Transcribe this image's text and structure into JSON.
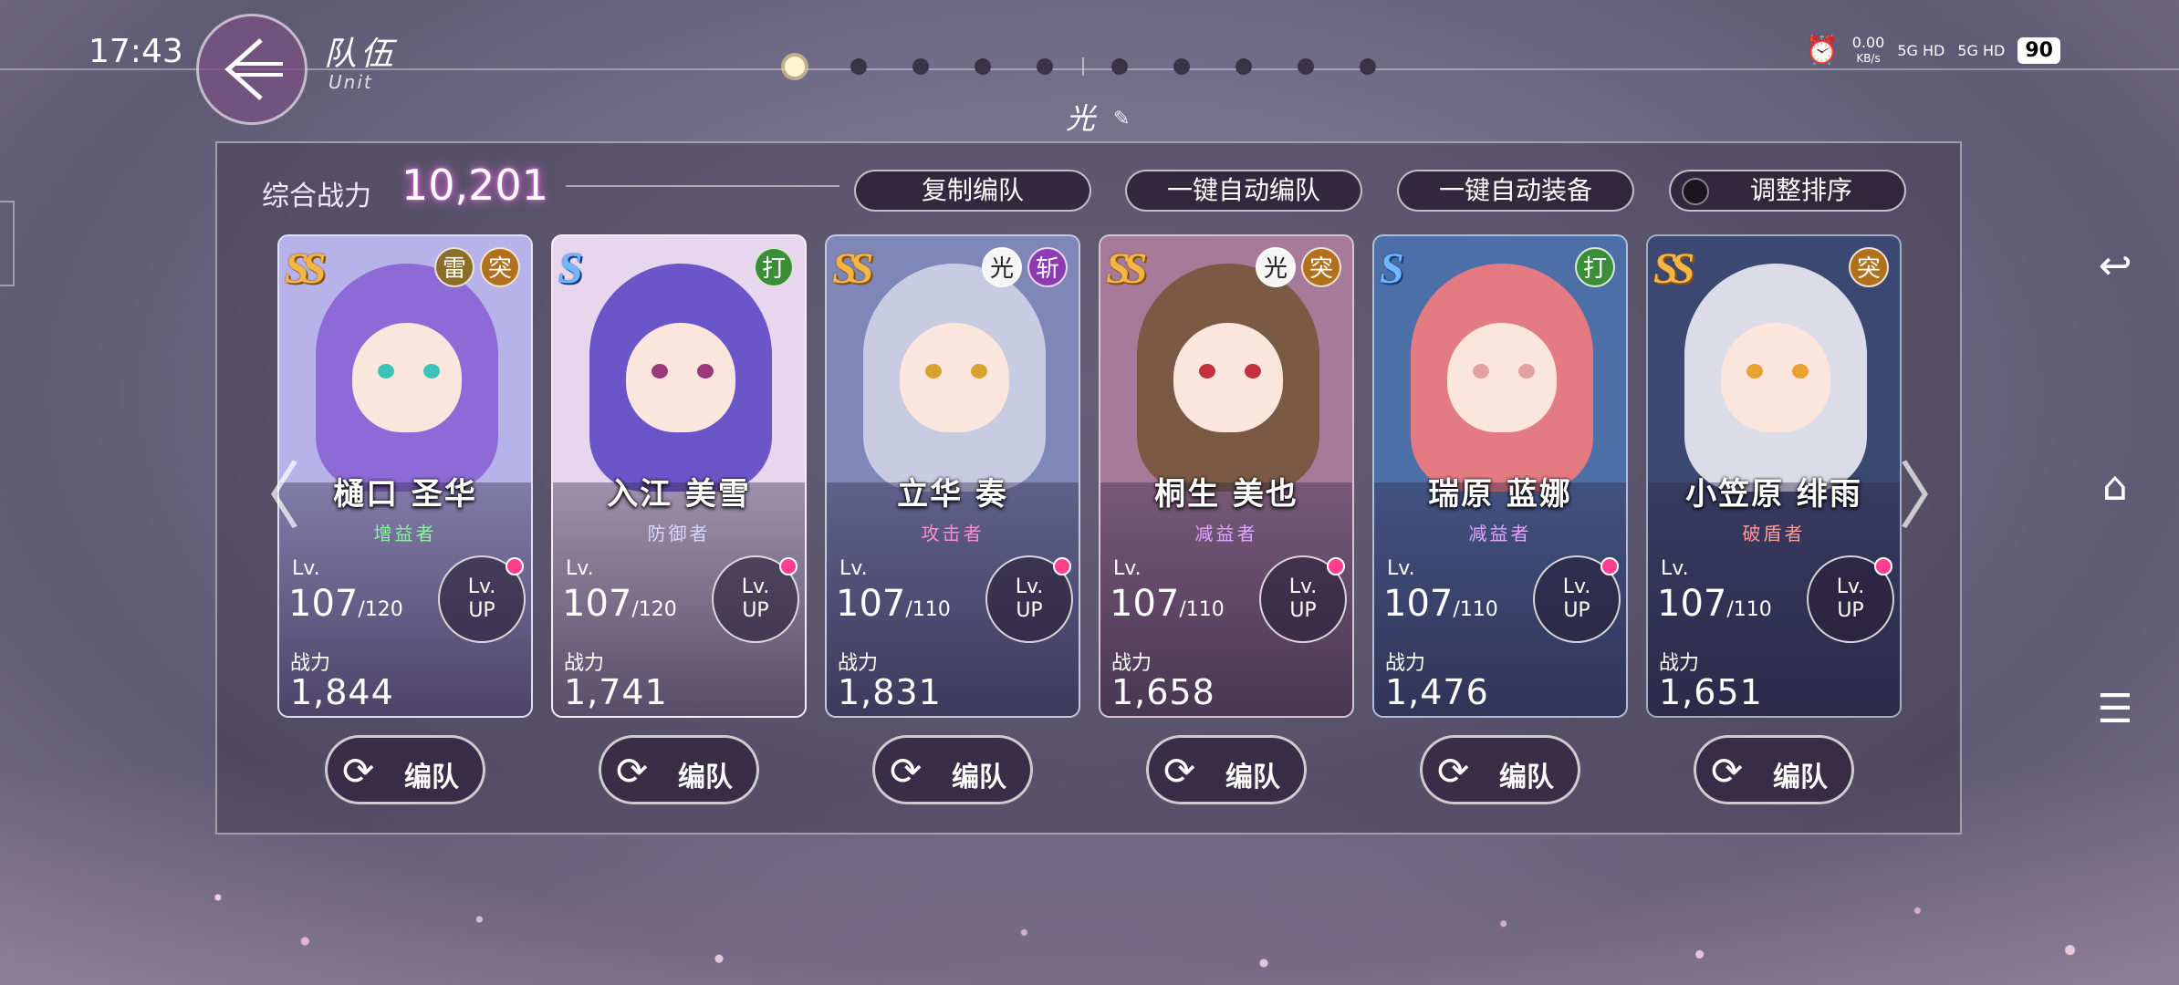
{
  "status": {
    "time": "17:43",
    "speed": "0.00",
    "speed_unit": "KB/s",
    "net1": "5G HD",
    "net2": "5G HD",
    "battery": "90"
  },
  "header": {
    "title": "队伍",
    "subtitle": "Unit",
    "team_name": "光"
  },
  "power": {
    "label": "综合战力",
    "value": "10,201"
  },
  "toolbar": {
    "copy": "复制编队",
    "auto_team": "一键自动编队",
    "auto_equip": "一键自动装备",
    "sort": "调整排序"
  },
  "lv_label": "Lv.",
  "lvup_line1": "Lv.",
  "lvup_line2": "UP",
  "power_label": "战力",
  "edit_label": "编队",
  "cards": [
    {
      "rarity": "SS",
      "name": "樋口 圣华",
      "role": "增益者",
      "role_color": "#8df0a6",
      "level": "107",
      "max": "/120",
      "power": "1,844",
      "badges": [
        "雷",
        "突"
      ],
      "badge_colors": [
        "#8c6d2a",
        "#b0701e"
      ],
      "hair": "#8e6ad6",
      "bg": "#b7b3ea",
      "eye": "#3ac3b8"
    },
    {
      "rarity": "S",
      "name": "入江 美雪",
      "role": "防御者",
      "role_color": "#d8d8ff",
      "level": "107",
      "max": "/120",
      "power": "1,741",
      "badges": [
        "打"
      ],
      "badge_colors": [
        "#3b8d3a"
      ],
      "hair": "#6a56c8",
      "bg": "#e8d6ef",
      "eye": "#9a3a7a"
    },
    {
      "rarity": "SS",
      "name": "立华 奏",
      "role": "攻击者",
      "role_color": "#ff8ecf",
      "level": "107",
      "max": "/110",
      "power": "1,831",
      "badges": [
        "光",
        "斩"
      ],
      "badge_colors": [
        "#f5f5f5",
        "#8e3ab0"
      ],
      "hair": "#c9cbe3",
      "bg": "#7f86b8",
      "eye": "#d9a22e"
    },
    {
      "rarity": "SS",
      "name": "桐生 美也",
      "role": "减益者",
      "role_color": "#e0a6ff",
      "level": "107",
      "max": "/110",
      "power": "1,658",
      "badges": [
        "光",
        "突"
      ],
      "badge_colors": [
        "#f5f5f5",
        "#b0701e"
      ],
      "hair": "#7a5a44",
      "bg": "#a87a9a",
      "eye": "#c43040"
    },
    {
      "rarity": "S",
      "name": "瑞原 蓝娜",
      "role": "减益者",
      "role_color": "#e0a6ff",
      "level": "107",
      "max": "/110",
      "power": "1,476",
      "badges": [
        "打"
      ],
      "badge_colors": [
        "#3b8d3a"
      ],
      "hair": "#e47a82",
      "bg": "#4d6fa8",
      "eye": "#e2a0a0"
    },
    {
      "rarity": "SS",
      "name": "小笠原 绯雨",
      "role": "破盾者",
      "role_color": "#ff9a9a",
      "level": "107",
      "max": "/110",
      "power": "1,651",
      "badges": [
        "突"
      ],
      "badge_colors": [
        "#b0701e"
      ],
      "hair": "#dcdce8",
      "bg": "#3b4872",
      "eye": "#e8a030"
    }
  ]
}
